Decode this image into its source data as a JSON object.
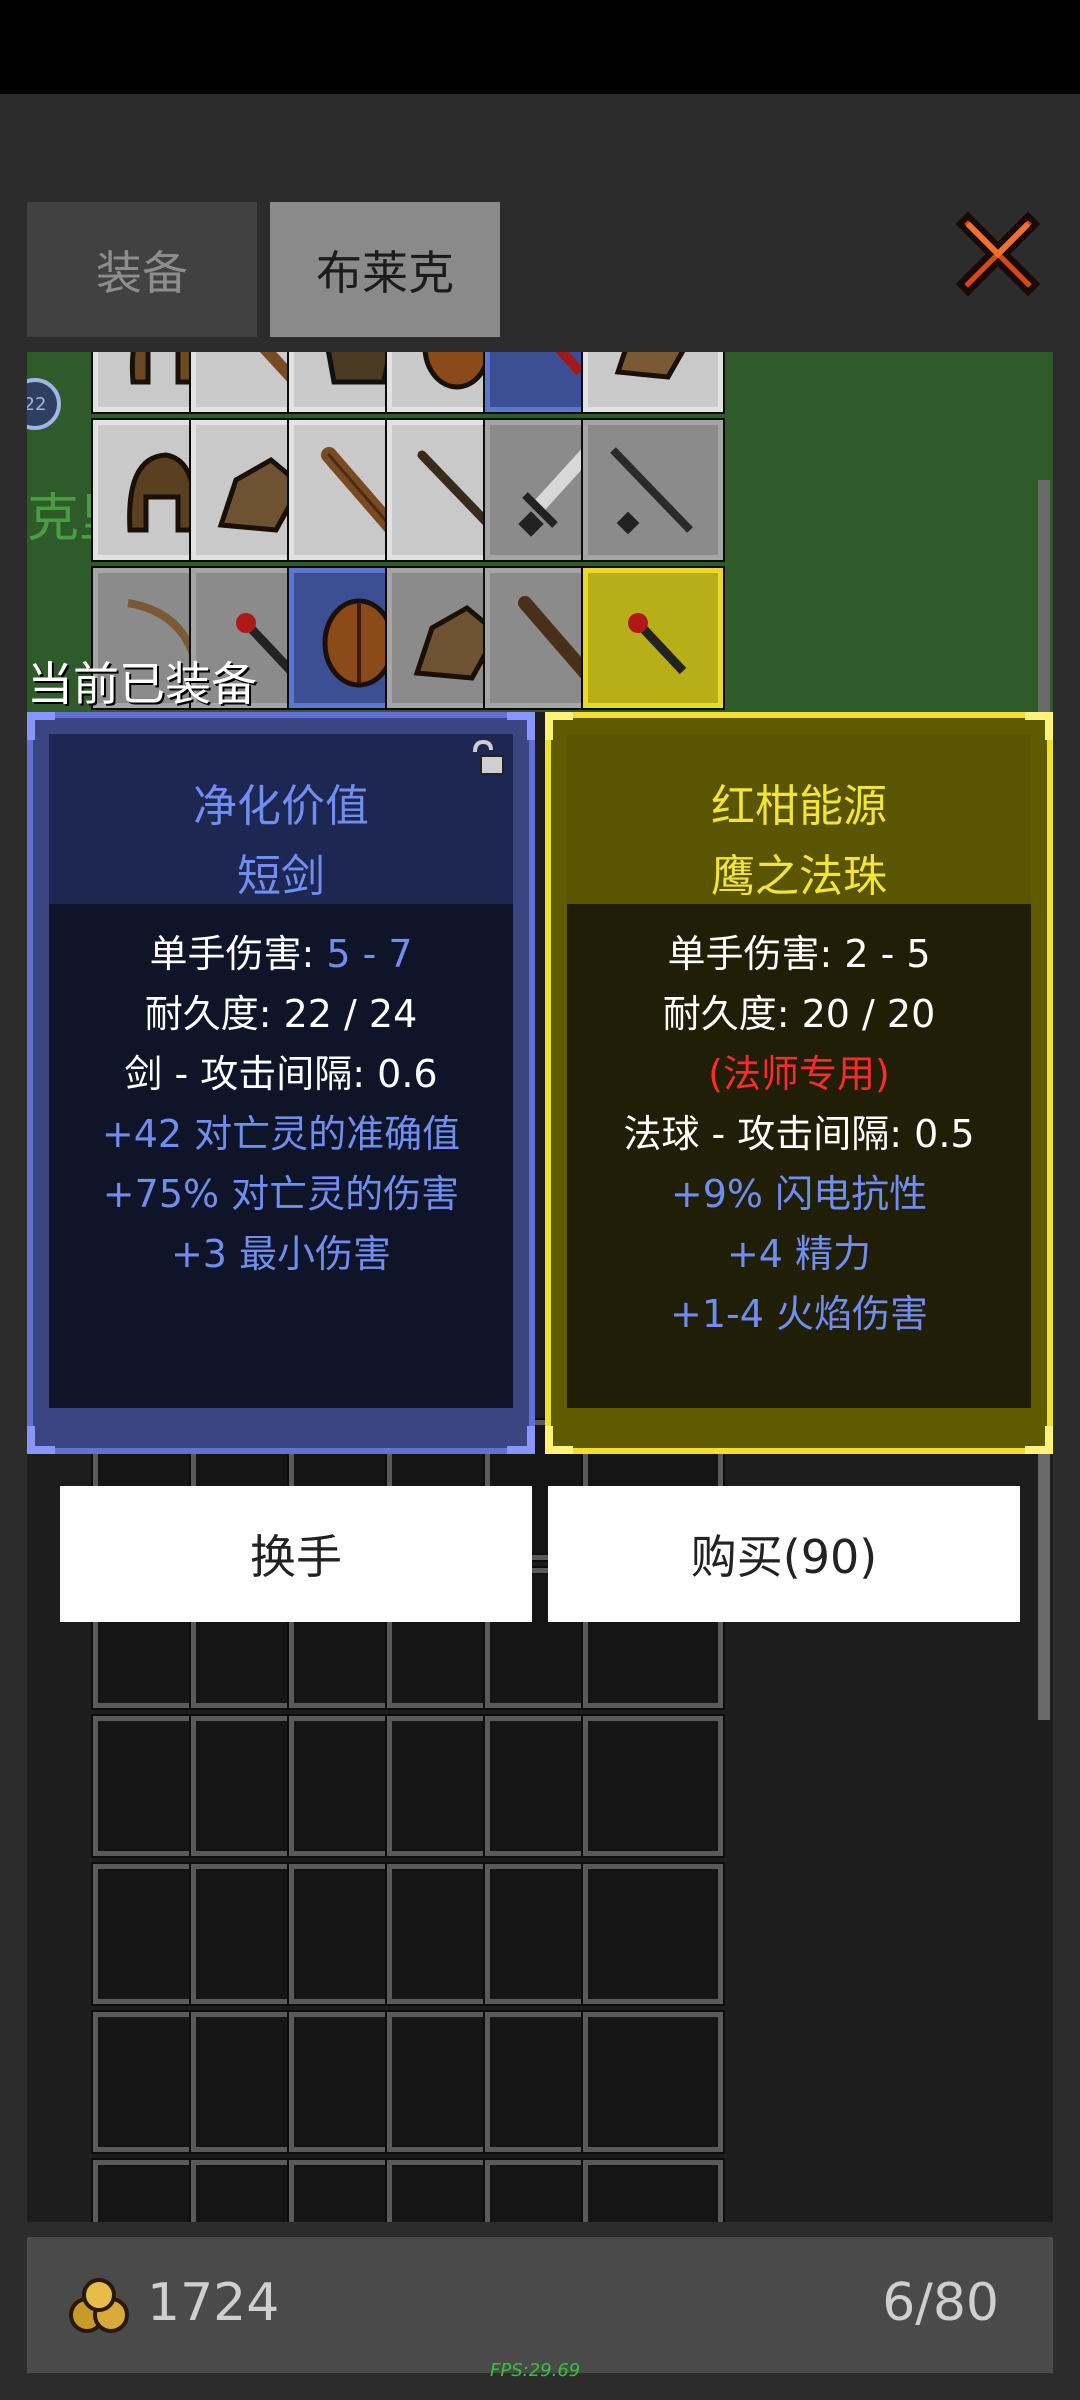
{
  "tabs": [
    {
      "label": "装备"
    },
    {
      "label": "布莱克"
    }
  ],
  "inventory": {
    "overlay_text": "克里",
    "badge": "22"
  },
  "equipped_label": "当前已装备",
  "left_item": {
    "name": "净化价值",
    "type": "短剑",
    "damage_label": "单手伤害: ",
    "damage_value": "5 - 7",
    "durability": "耐久度: 22 / 24",
    "speed": "剑 - 攻击间隔: 0.6",
    "bonuses": [
      "+42 对亡灵的准确值",
      "+75% 对亡灵的伤害",
      "+3 最小伤害"
    ]
  },
  "right_item": {
    "name": "红柑能源",
    "type": "鹰之法珠",
    "damage": "单手伤害: 2 - 5",
    "durability": "耐久度: 20 / 20",
    "restriction": "(法师专用)",
    "speed": "法球 - 攻击间隔: 0.5",
    "bonuses": [
      "+9% 闪电抗性",
      "+4 精力",
      "+1-4 火焰伤害"
    ]
  },
  "buttons": {
    "swap": "换手",
    "buy": "购买(90)"
  },
  "footer": {
    "gold": "1724",
    "capacity": "6/80"
  },
  "fps": "FPS:29.69",
  "colors": {
    "common_blue": "#6f8ef0",
    "rare_yellow": "#f3e43c",
    "restriction_red": "#ff2a2a"
  }
}
